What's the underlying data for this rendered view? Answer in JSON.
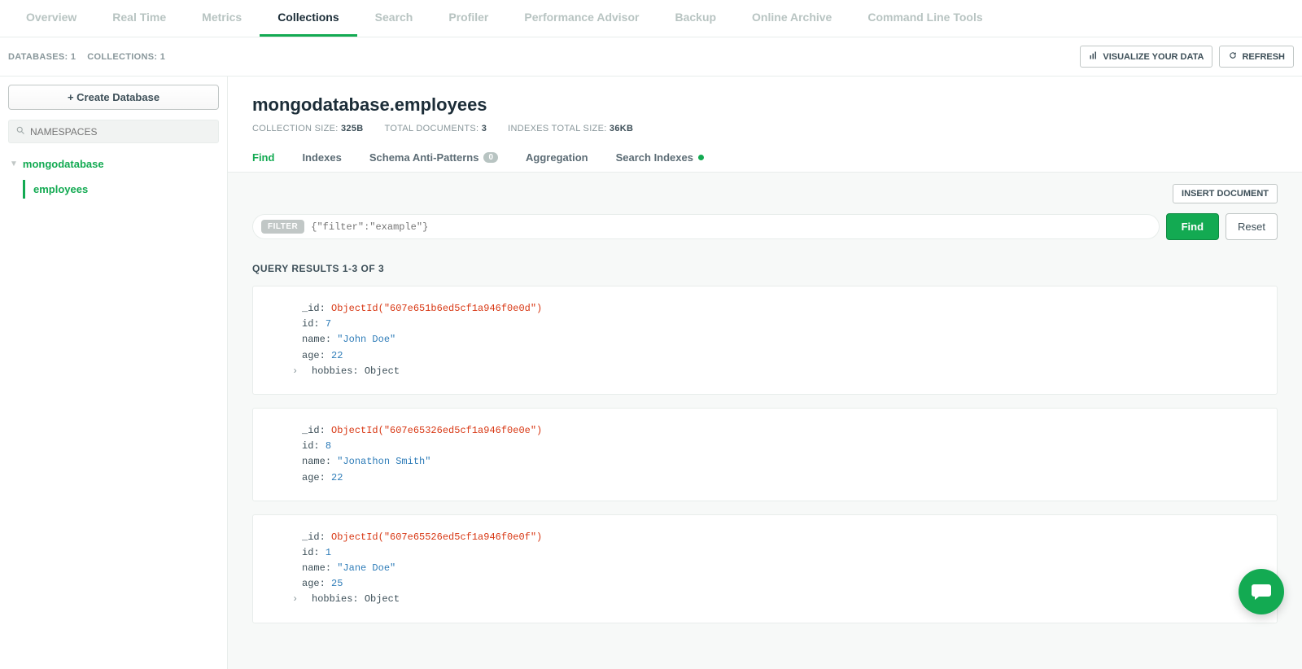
{
  "topTabs": [
    "Overview",
    "Real Time",
    "Metrics",
    "Collections",
    "Search",
    "Profiler",
    "Performance Advisor",
    "Backup",
    "Online Archive",
    "Command Line Tools"
  ],
  "topActive": "Collections",
  "counts": {
    "dbLabel": "DATABASES:",
    "dbVal": "1",
    "collLabel": "COLLECTIONS:",
    "collVal": "1"
  },
  "actions": {
    "visualize": "VISUALIZE YOUR DATA",
    "refresh": "REFRESH"
  },
  "sidebar": {
    "createDb": "+  Create Database",
    "nsPlaceholder": "NAMESPACES",
    "db": "mongodatabase",
    "coll": "employees"
  },
  "collection": {
    "title": "mongodatabase.employees",
    "sizeLabel": "COLLECTION SIZE:",
    "sizeVal": "325B",
    "docsLabel": "TOTAL DOCUMENTS:",
    "docsVal": "3",
    "idxLabel": "INDEXES TOTAL SIZE:",
    "idxVal": "36KB"
  },
  "subTabs": {
    "find": "Find",
    "indexes": "Indexes",
    "anti": "Schema Anti-Patterns",
    "antiCount": "0",
    "agg": "Aggregation",
    "search": "Search Indexes"
  },
  "insertDoc": "INSERT DOCUMENT",
  "filter": {
    "pill": "FILTER",
    "placeholder": "{\"filter\":\"example\"}",
    "find": "Find",
    "reset": "Reset"
  },
  "results": {
    "label": "QUERY RESULTS",
    "range": "1-3 OF 3"
  },
  "docs": [
    {
      "_id": "ObjectId(\"607e651b6ed5cf1a946f0e0d\")",
      "fields": [
        {
          "k": "id",
          "v": "7",
          "t": "num"
        },
        {
          "k": "name",
          "v": "\"John Doe\"",
          "t": "str"
        },
        {
          "k": "age",
          "v": "22",
          "t": "num"
        },
        {
          "k": "hobbies",
          "v": "Object",
          "t": "obj",
          "exp": true
        }
      ]
    },
    {
      "_id": "ObjectId(\"607e65326ed5cf1a946f0e0e\")",
      "fields": [
        {
          "k": "id",
          "v": "8",
          "t": "num"
        },
        {
          "k": "name",
          "v": "\"Jonathon Smith\"",
          "t": "str"
        },
        {
          "k": "age",
          "v": "22",
          "t": "num"
        }
      ]
    },
    {
      "_id": "ObjectId(\"607e65526ed5cf1a946f0e0f\")",
      "fields": [
        {
          "k": "id",
          "v": "1",
          "t": "num"
        },
        {
          "k": "name",
          "v": "\"Jane Doe\"",
          "t": "str"
        },
        {
          "k": "age",
          "v": "25",
          "t": "num"
        },
        {
          "k": "hobbies",
          "v": "Object",
          "t": "obj",
          "exp": true
        }
      ]
    }
  ]
}
